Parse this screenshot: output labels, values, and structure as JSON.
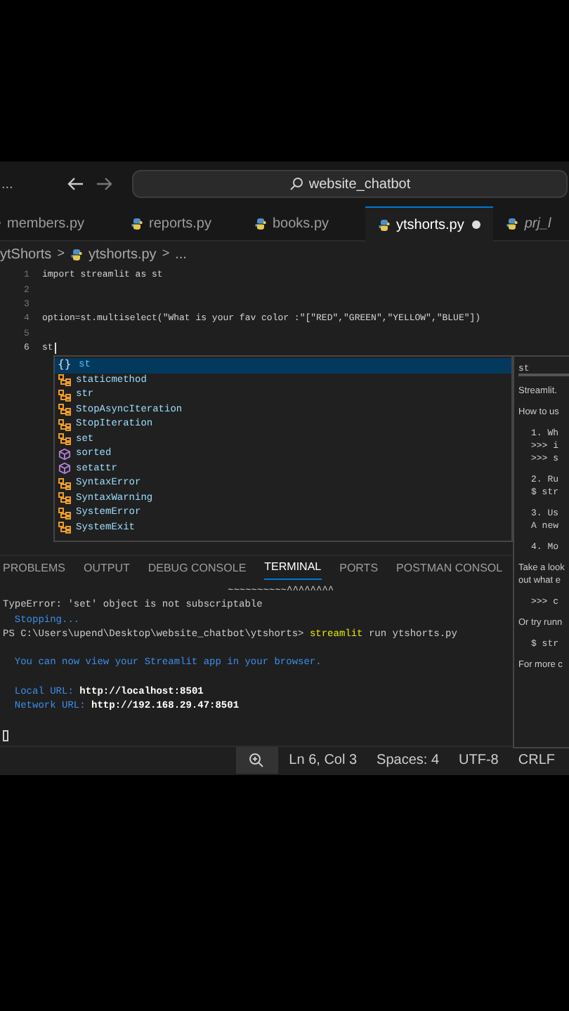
{
  "title_bar": {
    "menu": "...",
    "search": "website_chatbot"
  },
  "tabs": [
    {
      "label": "members.py",
      "selected": false,
      "modified": false,
      "preview": false
    },
    {
      "label": "reports.py",
      "selected": false,
      "modified": false,
      "preview": false
    },
    {
      "label": "books.py",
      "selected": false,
      "modified": false,
      "preview": false
    },
    {
      "label": "ytshorts.py",
      "selected": true,
      "modified": true,
      "preview": false
    },
    {
      "label": "prj_l",
      "selected": false,
      "modified": false,
      "preview": true
    }
  ],
  "breadcrumb": {
    "folder": "ytShorts",
    "separator_1": ">",
    "file": "ytshorts.py",
    "separator_2": ">",
    "rest": "..."
  },
  "editor": {
    "lines": [
      {
        "number": "1",
        "code": "import streamlit as st"
      },
      {
        "number": "2"
      },
      {
        "number": "3"
      },
      {
        "number": "4",
        "code": "option=st.multiselect(\"What is your fav color :\"[\"RED\",\"GREEN\",\"YELLOW\",\"BLUE\"])"
      },
      {
        "number": "5"
      },
      {
        "number": "6",
        "code": "st"
      }
    ]
  },
  "suggestions": [
    {
      "label": "st",
      "kind": "module",
      "icon": "{}",
      "selected": true
    },
    {
      "label": "staticmethod",
      "kind": "class",
      "selected": false
    },
    {
      "label": "str",
      "kind": "class",
      "selected": false
    },
    {
      "label": "StopAsyncIteration",
      "kind": "class",
      "selected": false
    },
    {
      "label": "StopIteration",
      "kind": "class",
      "selected": false
    },
    {
      "label": "set",
      "kind": "class",
      "selected": false
    },
    {
      "label": "sorted",
      "kind": "function",
      "selected": false
    },
    {
      "label": "setattr",
      "kind": "function",
      "selected": false
    },
    {
      "label": "SyntaxError",
      "kind": "class",
      "selected": false
    },
    {
      "label": "SyntaxWarning",
      "kind": "class",
      "selected": false
    },
    {
      "label": "SystemError",
      "kind": "class",
      "selected": false
    },
    {
      "label": "SystemExit",
      "kind": "class",
      "selected": false
    }
  ],
  "docs": {
    "title": "st",
    "blocks": [
      {
        "kind": "text",
        "text": "Streamlit."
      },
      {
        "kind": "text",
        "text": "How to us"
      },
      {
        "kind": "code",
        "lines": [
          "1. Wh",
          ">>> i",
          ">>> s"
        ]
      },
      {
        "kind": "code",
        "lines": [
          "2. Ru",
          "$ str"
        ]
      },
      {
        "kind": "code",
        "lines": [
          "3. Us",
          "A new"
        ]
      },
      {
        "kind": "code",
        "lines": [
          "4. Mo"
        ]
      },
      {
        "kind": "text",
        "text": "Take a look out what e"
      },
      {
        "kind": "code",
        "lines": [
          ">>> c"
        ]
      },
      {
        "kind": "text",
        "text": "Or try runn"
      },
      {
        "kind": "code",
        "lines": [
          "$ str"
        ]
      },
      {
        "kind": "text",
        "text": "For more c"
      }
    ]
  },
  "panel_tabs": [
    {
      "label": "PROBLEMS",
      "selected": false
    },
    {
      "label": "OUTPUT",
      "selected": false
    },
    {
      "label": "DEBUG CONSOLE",
      "selected": false
    },
    {
      "label": "TERMINAL",
      "selected": true
    },
    {
      "label": "PORTS",
      "selected": false
    },
    {
      "label": "POSTMAN CONSOL",
      "selected": false
    }
  ],
  "terminal": [
    {
      "kind": "marker",
      "text": "~~~~~~~~~~^^^^^^^^"
    },
    {
      "kind": "plain",
      "text": "TypeError: 'set' object is not subscriptable"
    },
    {
      "kind": "info",
      "text": "  Stopping..."
    },
    {
      "kind": "command",
      "prompt": "PS C:\\Users\\upend\\Desktop\\website_chatbot\\ytshorts>",
      "command": "streamlit",
      "args": "run ytshorts.py"
    },
    {
      "kind": "blank"
    },
    {
      "kind": "info",
      "text": "  You can now view your Streamlit app in your browser."
    },
    {
      "kind": "blank"
    },
    {
      "kind": "url",
      "label": "  Local URL:",
      "value": "http://localhost:8501"
    },
    {
      "kind": "url",
      "label": "  Network URL:",
      "value": "http://192.168.29.47:8501"
    },
    {
      "kind": "blank"
    },
    {
      "kind": "cursor"
    }
  ],
  "status_bar": [
    "Ln 6, Col 3",
    "Spaces: 4",
    "UTF-8",
    "CRLF"
  ]
}
